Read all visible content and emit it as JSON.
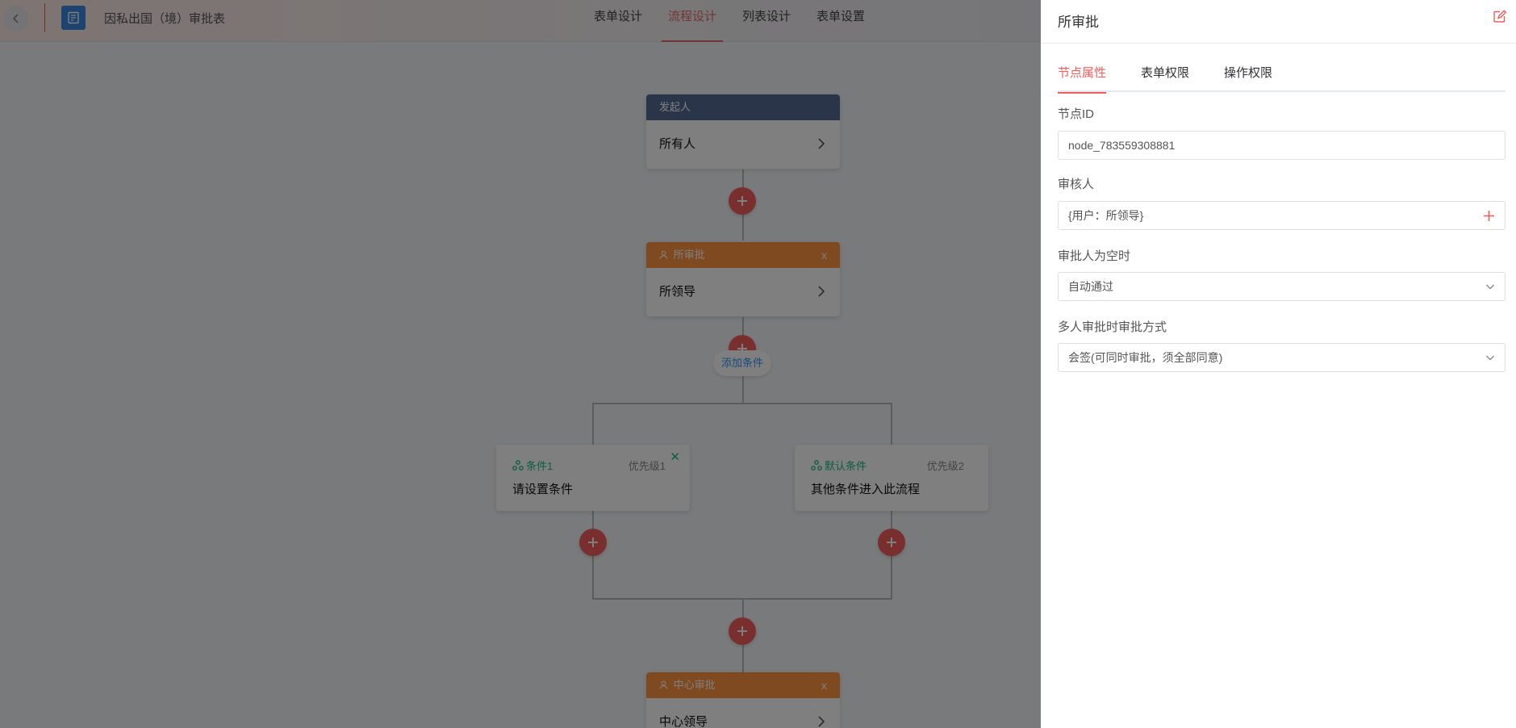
{
  "header": {
    "form_title": "因私出国（境）审批表",
    "tabs": [
      "表单设计",
      "流程设计",
      "列表设计",
      "表单设置"
    ],
    "active_tab": "流程设计"
  },
  "flow": {
    "start_node": {
      "header": "发起人",
      "content": "所有人"
    },
    "approval_node": {
      "header": "所审批",
      "content": "所领导",
      "close": "x"
    },
    "add_condition_label": "添加条件",
    "conditions": [
      {
        "title": "条件1",
        "priority": "优先级1",
        "content": "请设置条件",
        "close": "✕"
      },
      {
        "title": "默认条件",
        "priority": "优先级2",
        "content": "其他条件进入此流程"
      }
    ],
    "center_node": {
      "header": "中心审批",
      "content": "中心领导",
      "close": "x"
    }
  },
  "drawer": {
    "title": "所审批",
    "tabs": [
      "节点属性",
      "表单权限",
      "操作权限"
    ],
    "active_tab": "节点属性",
    "node_id_label": "节点ID",
    "node_id_value": "node_783559308881",
    "reviewer_label": "审核人",
    "reviewer_value": "{用户：所领导}",
    "empty_approver_label": "审批人为空时",
    "empty_approver_value": "自动通过",
    "multi_mode_label": "多人审批时审批方式",
    "multi_mode_value": "会签(可同时审批，须全部同意)"
  },
  "colors": {
    "accent_red": "#f55e5e",
    "start_header": "#576a95",
    "approver_header": "#ff943e",
    "condition_green": "#15bc83",
    "link_blue": "#3296fa"
  }
}
